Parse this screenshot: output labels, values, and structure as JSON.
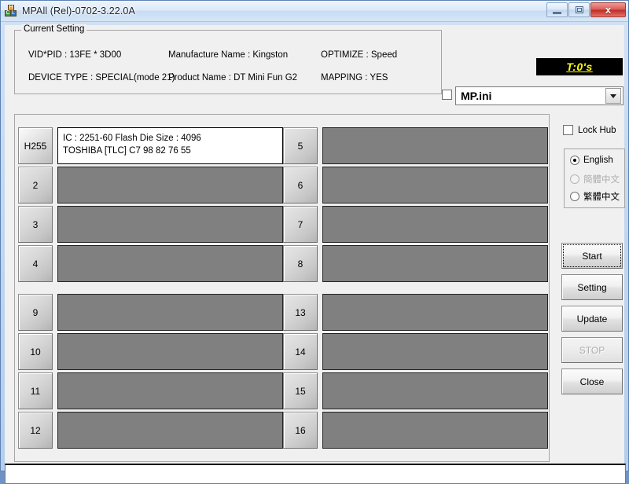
{
  "window": {
    "title": "MPAll (Rel)-0702-3.22.0A",
    "icon": "app-blocks-icon",
    "minimize_label": "",
    "maximize_label": "",
    "close_label": "x"
  },
  "current_setting": {
    "legend": "Current Setting",
    "vid_pid": "VID*PID : 13FE * 3D00",
    "device_type": "DEVICE TYPE : SPECIAL(mode 21)",
    "manufacture_name": "Manufacture Name : Kingston",
    "product_name": "Product Name : DT Mini Fun G2",
    "optimize": "OPTIMIZE : Speed",
    "mapping": "MAPPING : YES"
  },
  "counter": {
    "text": "T:0's",
    "bg_color": "#000000",
    "fg_color": "#ffff00"
  },
  "ini_selector": {
    "checkbox_checked": false,
    "value": "MP.ini",
    "dropdown_icon": "chevron-down-icon"
  },
  "ports": {
    "left": [
      {
        "num": "H255",
        "active": true,
        "lines": [
          "IC : 2251-60  Flash Die Size : 4096",
          "TOSHIBA [TLC] C7 98 82 76 55"
        ]
      },
      {
        "num": "2",
        "active": false,
        "lines": []
      },
      {
        "num": "3",
        "active": false,
        "lines": []
      },
      {
        "num": "4",
        "active": false,
        "lines": []
      },
      {
        "num": "9",
        "active": false,
        "lines": []
      },
      {
        "num": "10",
        "active": false,
        "lines": []
      },
      {
        "num": "11",
        "active": false,
        "lines": []
      },
      {
        "num": "12",
        "active": false,
        "lines": []
      }
    ],
    "right": [
      {
        "num": "5",
        "active": false,
        "lines": []
      },
      {
        "num": "6",
        "active": false,
        "lines": []
      },
      {
        "num": "7",
        "active": false,
        "lines": []
      },
      {
        "num": "8",
        "active": false,
        "lines": []
      },
      {
        "num": "13",
        "active": false,
        "lines": []
      },
      {
        "num": "14",
        "active": false,
        "lines": []
      },
      {
        "num": "15",
        "active": false,
        "lines": []
      },
      {
        "num": "16",
        "active": false,
        "lines": []
      }
    ],
    "empty_color": "#808080",
    "active_color": "#ffffff"
  },
  "right_panel": {
    "lock_hub": {
      "label": "Lock Hub",
      "checked": false
    },
    "languages": [
      {
        "label": "English",
        "selected": true,
        "disabled": false
      },
      {
        "label": "簡體中文",
        "selected": false,
        "disabled": true
      },
      {
        "label": "繁體中文",
        "selected": false,
        "disabled": false
      }
    ],
    "buttons": [
      {
        "id": "start",
        "label": "Start",
        "disabled": false,
        "focused": true
      },
      {
        "id": "setting",
        "label": "Setting",
        "disabled": false,
        "focused": false
      },
      {
        "id": "update",
        "label": "Update",
        "disabled": false,
        "focused": false
      },
      {
        "id": "stop",
        "label": "STOP",
        "disabled": true,
        "focused": false
      },
      {
        "id": "close",
        "label": "Close",
        "disabled": false,
        "focused": false
      }
    ]
  },
  "status_bar": {
    "text": ""
  }
}
